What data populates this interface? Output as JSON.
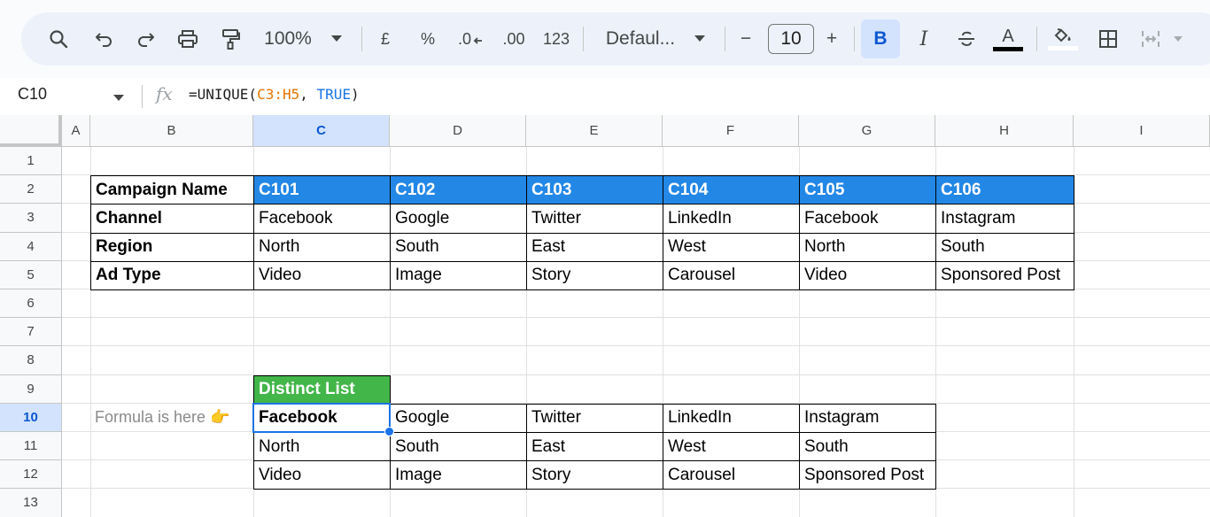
{
  "toolbar": {
    "zoom": "100%",
    "currency": "£",
    "percent": "%",
    "decrease_decimal": ".0",
    "increase_decimal": ".00",
    "number_format": "123",
    "font": "Defaul...",
    "font_size": "10",
    "minus": "−",
    "plus": "+",
    "bold": "B",
    "italic": "I",
    "text_color_letter": "A"
  },
  "formula_bar": {
    "cell_ref": "C10",
    "formula_prefix": "=UNIQUE(",
    "formula_range": "C3:H5",
    "formula_sep": ", ",
    "formula_bool": "TRUE",
    "formula_suffix": ")"
  },
  "grid": {
    "columns": [
      "A",
      "B",
      "C",
      "D",
      "E",
      "F",
      "G",
      "H",
      "I"
    ],
    "rows": [
      "1",
      "2",
      "3",
      "4",
      "5",
      "6",
      "7",
      "8",
      "9",
      "10",
      "11",
      "12",
      "13"
    ],
    "selected_column": "C",
    "selected_row": "10"
  },
  "table": {
    "header_label": "Campaign Name",
    "campaigns": [
      "C101",
      "C102",
      "C103",
      "C104",
      "C105",
      "C106"
    ],
    "rows": [
      {
        "label": "Channel",
        "values": [
          "Facebook",
          "Google",
          "Twitter",
          "LinkedIn",
          "Facebook",
          "Instagram"
        ]
      },
      {
        "label": "Region",
        "values": [
          "North",
          "South",
          "East",
          "West",
          "North",
          "South"
        ]
      },
      {
        "label": "Ad Type",
        "values": [
          "Video",
          "Image",
          "Story",
          "Carousel",
          "Video",
          "Sponsored Post"
        ]
      }
    ]
  },
  "distinct": {
    "title": "Distinct List",
    "note": "Formula is here 👉",
    "rows": [
      [
        "Facebook",
        "Google",
        "Twitter",
        "LinkedIn",
        "Instagram"
      ],
      [
        "North",
        "South",
        "East",
        "West",
        "South"
      ],
      [
        "Video",
        "Image",
        "Story",
        "Carousel",
        "Sponsored Post"
      ]
    ]
  },
  "colors": {
    "header_blue": "#2387e6",
    "header_green": "#43b64a",
    "selection": "#1a73e8"
  }
}
